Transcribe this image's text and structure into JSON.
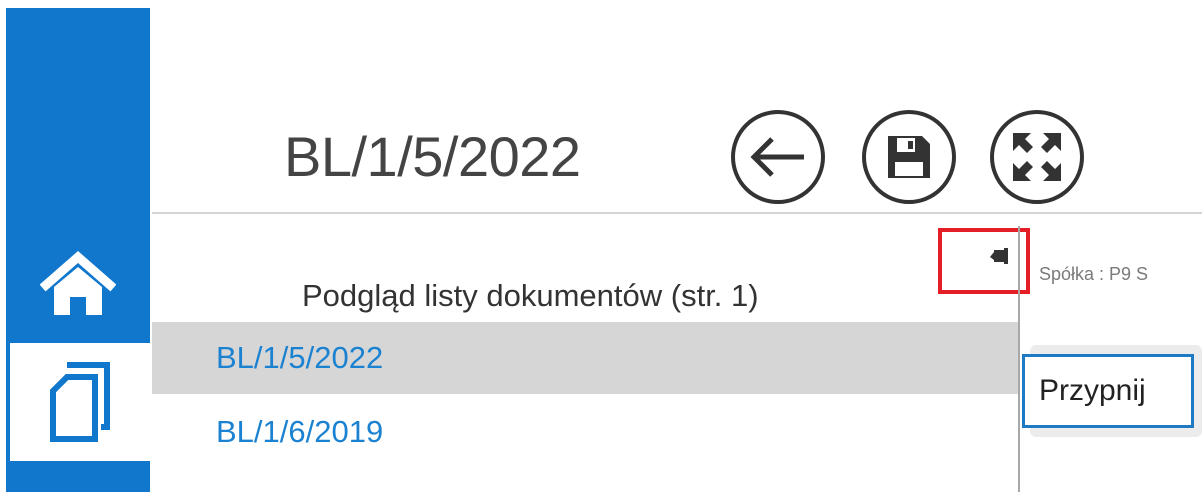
{
  "document": {
    "title": "BL/1/5/2022"
  },
  "toolbar": {
    "back_icon": "arrow-left-icon",
    "save_icon": "floppy-disk-icon",
    "fullscreen_icon": "expand-arrows-icon"
  },
  "nav": {
    "items": [
      {
        "name": "home",
        "icon": "home-icon",
        "active": false
      },
      {
        "name": "documents",
        "icon": "documents-icon",
        "active": true
      }
    ],
    "accent": "#1177cc"
  },
  "list": {
    "header": "Podgląd listy dokumentów (str. 1)",
    "items": [
      {
        "label": "BL/1/5/2022",
        "selected": true
      },
      {
        "label": "BL/1/6/2019",
        "selected": false
      }
    ],
    "pin_icon": "pin-icon",
    "link_color": "#1b82d2"
  },
  "details": {
    "company_label": "Spółka : P9 S",
    "tooltip": "Przypnij"
  },
  "highlight_color": "#e31e24"
}
